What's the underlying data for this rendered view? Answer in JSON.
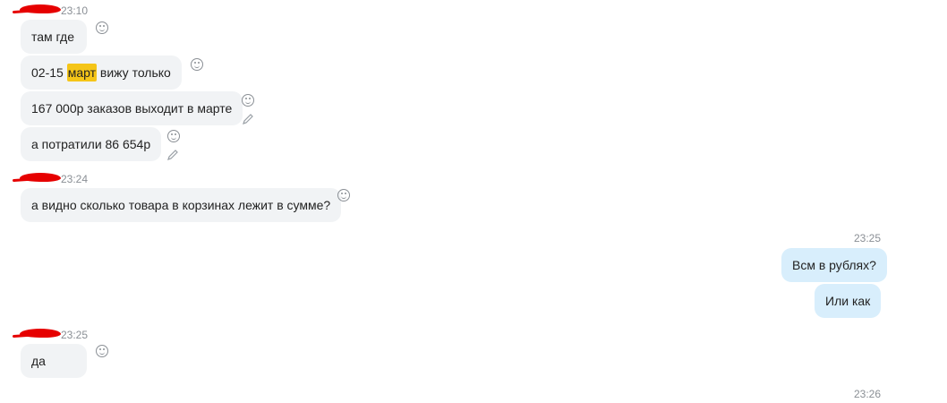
{
  "groups": [
    {
      "time": "23:10"
    },
    {
      "time": "23:24"
    },
    {
      "time": "23:25"
    }
  ],
  "messages": {
    "m1": "там где",
    "m2_prefix": "02-15",
    "m2_highlight": "март",
    "m2_suffix": "вижу только",
    "m3": "167 000р заказов выходит в марте",
    "m4": "а потратили 86 654р",
    "m5": "а видно сколько товара в корзинах лежит в сумме?",
    "out_time": "23:25",
    "out1": "Всм в рублях?",
    "out2": "Или как",
    "m6": "да",
    "bottom_time": "23:26"
  },
  "colors": {
    "incoming_bubble": "#f1f3f5",
    "outgoing_bubble": "#d8eefc",
    "highlight": "#f5c518",
    "redaction": "#e60000"
  },
  "icons": [
    "smile-icon",
    "pencil-icon"
  ]
}
